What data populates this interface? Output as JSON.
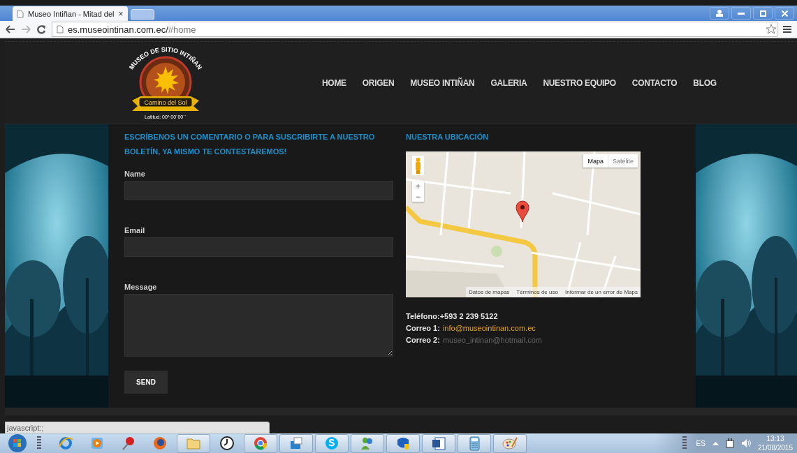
{
  "browser": {
    "tabs": [
      {
        "title": "Museo Intiñan - Mitad del",
        "kind": "page",
        "close": "×",
        "selected": true
      },
      {
        "kind": "new",
        "selected": false
      }
    ],
    "address": {
      "host": "es.museointinan.com.ec/",
      "fragment": "#home"
    }
  },
  "site": {
    "logo": {
      "title": "MUSEO DE SITIO INTIÑAN",
      "ribbon": "Camino del Sol",
      "latitude": "Latitud: 00º 00´00´´"
    },
    "nav": [
      {
        "label": "HOME"
      },
      {
        "label": "ORIGEN"
      },
      {
        "label": "MUSEO INTIÑAN"
      },
      {
        "label": "GALERIA"
      },
      {
        "label": "NUESTRO EQUIPO"
      },
      {
        "label": "CONTACTO"
      },
      {
        "label": "BLOG"
      }
    ],
    "form": {
      "heading": "ESCRÍBENOS UN COMENTARIO O PARA SUSCRIBIRTE A NUESTRO BOLETÍN, YA MISMO TE CONTESTAREMOS!",
      "fields": [
        {
          "label": "Name",
          "kind": "input"
        },
        {
          "label": "Email",
          "kind": "input"
        },
        {
          "label": "Message",
          "kind": "textarea"
        }
      ],
      "button": "SEND"
    },
    "location": {
      "heading": "NUESTRA UBICACIÓN",
      "map": {
        "kind": "picture",
        "types": [
          {
            "label": "Mapa",
            "selected": true
          },
          {
            "label": "Satélite",
            "selected": false
          }
        ],
        "zoom": [
          "+",
          "−"
        ],
        "attributions": [
          "Datos de mapas",
          "Términos de uso",
          "Informar de un error de Maps"
        ]
      },
      "contacts": [
        {
          "label": "Teléfono:+593 2 239 5122"
        },
        {
          "label": "Correo 1:",
          "value": "info@museointinan.com.ec",
          "color": "#e8a317"
        },
        {
          "label": "Correo 2:",
          "value": "museo_intinan@hotmail.com",
          "color": "#666666"
        }
      ]
    }
  },
  "status_bubble": "javascript:;",
  "taskbar": {
    "apps": [
      {
        "kind": "ie",
        "open": false
      },
      {
        "kind": "media",
        "open": false
      },
      {
        "kind": "pin",
        "open": false
      },
      {
        "kind": "firefox",
        "open": false
      },
      {
        "kind": "folder",
        "open": true
      },
      {
        "kind": "clock",
        "open": false
      },
      {
        "kind": "chrome",
        "open": true
      },
      {
        "kind": "photos",
        "open": true
      },
      {
        "kind": "skype",
        "open": true
      },
      {
        "kind": "messenger",
        "open": true
      },
      {
        "kind": "shield",
        "open": true
      },
      {
        "kind": "word",
        "open": true
      },
      {
        "kind": "calculator",
        "open": true
      },
      {
        "kind": "paint",
        "open": true
      }
    ],
    "language": "ES",
    "time": "13:13",
    "date": "21/08/2015"
  }
}
